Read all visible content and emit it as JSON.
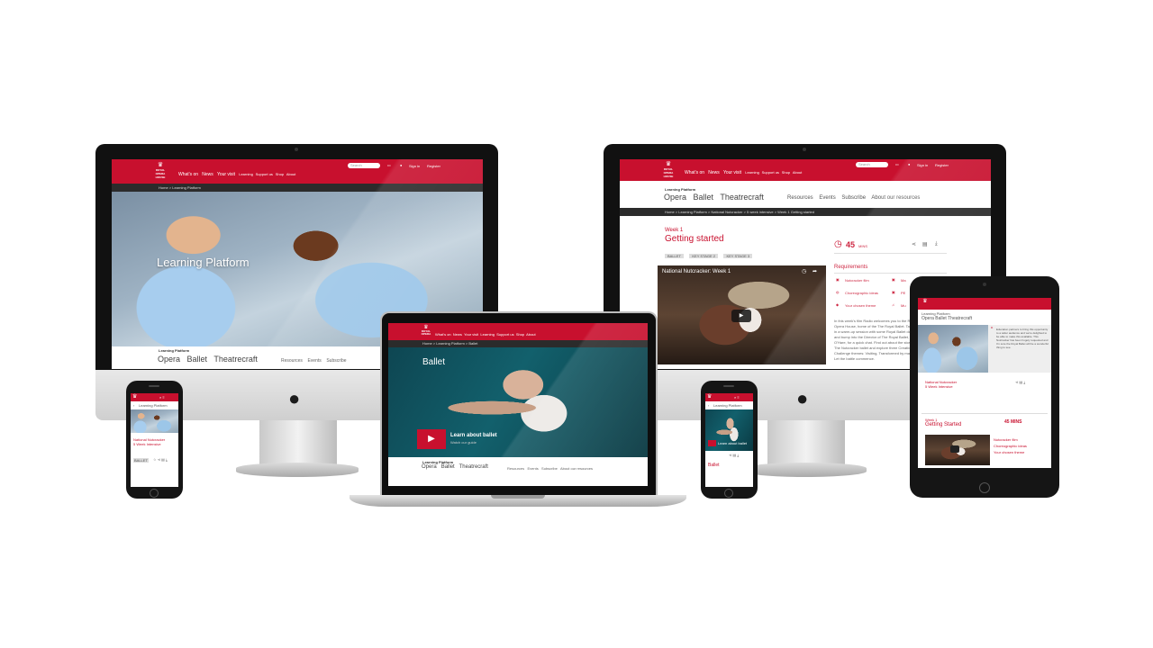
{
  "site": {
    "logo_lines": [
      "ROYAL",
      "OPERA",
      "HOUSE"
    ],
    "nav_main": [
      "What's on",
      "News",
      "Your visit"
    ],
    "nav_secondary": [
      "Learning",
      "Support us",
      "Shop",
      "About"
    ],
    "search_placeholder": "Search",
    "sign_in": "Sign in",
    "register": "Register"
  },
  "left_imac": {
    "breadcrumb": "Home > Learning Platform",
    "hero_title": "Learning Platform",
    "subnav_label": "Learning Platform",
    "subnav_big": [
      "Opera",
      "Ballet",
      "Theatrecraft"
    ],
    "subnav_small": [
      "Resources",
      "Events",
      "Subscribe"
    ]
  },
  "right_imac": {
    "subnav_label": "Learning Platform",
    "subnav_big": [
      "Opera",
      "Ballet",
      "Theatrecraft"
    ],
    "subnav_small": [
      "Resources",
      "Events",
      "Subscribe",
      "About our resources"
    ],
    "breadcrumb": "Home > Learning Platform > National Nutcracker > 5 week intensive > Week 1 Getting started",
    "week": "Week 1",
    "page_title": "Getting started",
    "tags": [
      "BALLET",
      "KEY STAGE 2",
      "KEY STAGE 3"
    ],
    "duration_value": "45",
    "duration_unit": "MINS",
    "video_title": "National Nutcracker: Week 1",
    "requirements_heading": "Requirements",
    "requirements": [
      "Nutcracker film",
      "Choreographic ideas",
      "Your chosen theme"
    ],
    "requirements_right": [
      "Ma",
      "PE",
      "Mu"
    ],
    "body_text": "In this week's film Radio welcomes you to the Royal Opera House, home of the The Royal Ballet. Take part in a warm-up session with some Royal Ballet dancers and bump into the Director of The Royal Ballet, Kevin O'Hare, for a quick chat. Find out about the story of The Nutcracker ballet and explore three Creative Challenge themes: Visiting, Transformed by magic and Let the battle commence."
  },
  "laptop": {
    "breadcrumb": "Home > Learning Platform > Ballet",
    "hero_title": "Ballet",
    "cta_title": "Learn about ballet",
    "cta_sub": "Watch our guide",
    "subnav_label": "Learning Platform",
    "subnav_big": [
      "Opera",
      "Ballet",
      "Theatrecraft"
    ],
    "subnav_small": [
      "Resources",
      "Events",
      "Subscribe",
      "About our resources"
    ]
  },
  "phone_left": {
    "crumb": "Learning Platform",
    "title_line1": "National Nutcracker",
    "title_line2": "5 Week Intensive"
  },
  "phone_mid": {
    "crumb": "Learning Platform",
    "cta": "Learn about ballet",
    "title": "Ballet"
  },
  "tablet": {
    "quote": "Education partners to bring this opportunity to a wider audience and we're delighted to be able to make this available. This Nutcracker has been hugely requested and I'm sure the Royal Ballet will be a wonderful thing to see.",
    "item_line1": "National Nutcracker",
    "item_line2": "5 Week Intensive",
    "week": "Week 1",
    "title": "Getting Started",
    "duration": "45 MINS"
  },
  "colors": {
    "brand_red": "#c8102e",
    "dark_bar": "#2b2b2b"
  }
}
